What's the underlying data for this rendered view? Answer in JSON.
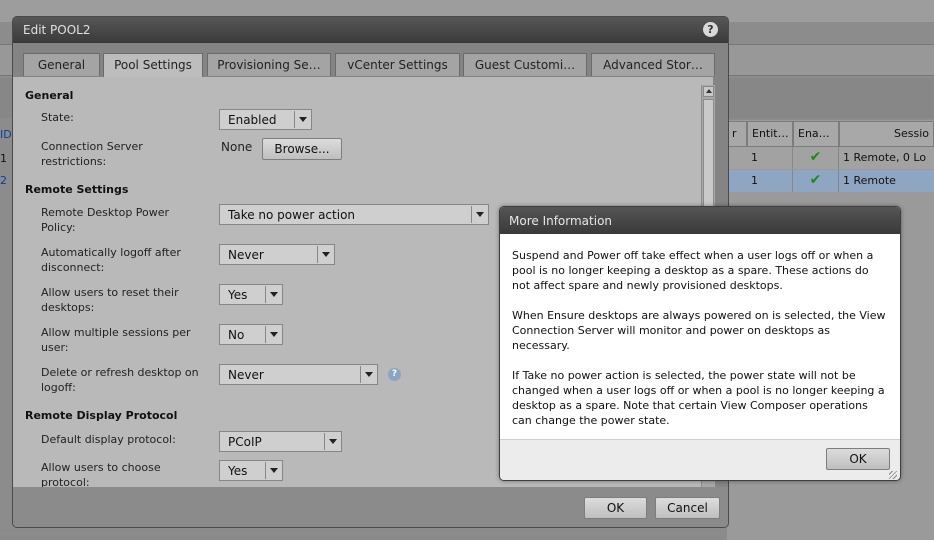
{
  "background": {
    "grid": {
      "headers": [
        "r",
        "Entit…",
        "Ena…",
        "Sessio"
      ],
      "rows": [
        {
          "entitled": "1",
          "sessions": "1 Remote, 0 Lo"
        },
        {
          "entitled": "1",
          "sessions": "1 Remote"
        }
      ],
      "left_labels": [
        "ID",
        "1",
        "2"
      ]
    }
  },
  "dialog": {
    "title": "Edit POOL2",
    "help_glyph": "?",
    "tabs": [
      {
        "label": "General"
      },
      {
        "label": "Pool Settings",
        "active": true
      },
      {
        "label": "Provisioning Se…"
      },
      {
        "label": "vCenter Settings"
      },
      {
        "label": "Guest Customi…"
      },
      {
        "label": "Advanced Stor…"
      }
    ],
    "sections": {
      "general": "General",
      "remote_settings": "Remote Settings",
      "remote_display": "Remote Display Protocol"
    },
    "fields": {
      "state": {
        "label": "State:",
        "value": "Enabled"
      },
      "conn_server": {
        "label_line1": "Connection Server",
        "label_line2": "restrictions:",
        "value": "None",
        "button": "Browse..."
      },
      "power_policy": {
        "label_line1": "Remote Desktop Power",
        "label_line2": "Policy:",
        "value": "Take no power action"
      },
      "auto_logoff": {
        "label_line1": "Automatically logoff after",
        "label_line2": "disconnect:",
        "value": "Never"
      },
      "allow_reset": {
        "label_line1": "Allow users to reset their",
        "label_line2": "desktops:",
        "value": "Yes"
      },
      "multi_sessions": {
        "label_line1": "Allow multiple sessions per",
        "label_line2": "user:",
        "value": "No"
      },
      "delete_refresh": {
        "label_line1": "Delete or refresh desktop on",
        "label_line2": "logoff:",
        "value": "Never"
      },
      "display_protocol": {
        "label": "Default display protocol:",
        "value": "PCoIP"
      },
      "choose_protocol": {
        "label_line1": "Allow users to choose",
        "label_line2": "protocol:",
        "value": "Yes"
      }
    },
    "ok_label": "OK",
    "cancel_label": "Cancel",
    "help_icon_glyph": "?"
  },
  "info_popup": {
    "title": "More Information",
    "paragraphs": [
      "Suspend and Power off take effect when a user logs off or when a pool is no longer keeping a desktop as a spare. These actions do not affect spare and newly provisioned desktops.",
      "When Ensure desktops are always powered on is selected, the View Connection Server will monitor and power on desktops as necessary.",
      "If Take no power action is selected, the power state will not be changed when a user logs off or when a pool is no longer keeping a desktop as a spare. Note that certain View Composer operations can change the power state."
    ],
    "ok_label": "OK"
  },
  "colors": {
    "check": "#1a8a1a",
    "title_bar": "#3d3d3d",
    "selected_row": "#8fa6c2"
  }
}
